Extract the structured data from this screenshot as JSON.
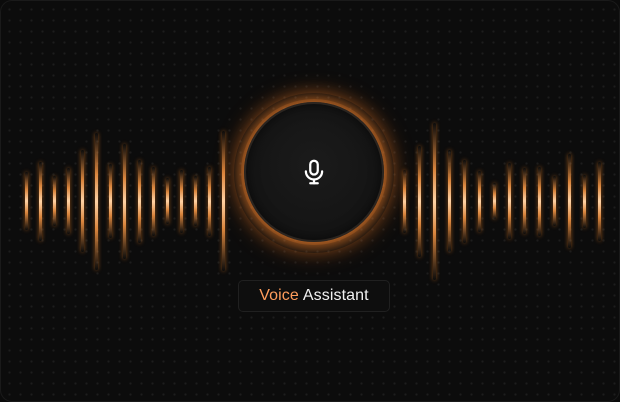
{
  "assistant": {
    "label_accent": "Voice",
    "label_rest": "Assistant",
    "icon": "microphone-icon"
  },
  "theme": {
    "accent": "#ff9d5c",
    "glow": "#ff8a2e",
    "background": "#0c0c0c",
    "text": "#f2f2f2"
  },
  "waveform": {
    "left_levels": [
      0.35,
      0.48,
      0.3,
      0.4,
      0.62,
      0.83,
      0.45,
      0.7,
      0.5,
      0.42,
      0.28,
      0.38,
      0.3,
      0.42,
      0.85
    ],
    "right_levels": [
      0.38,
      0.67,
      0.95,
      0.62,
      0.5,
      0.37,
      0.22,
      0.46,
      0.4,
      0.42,
      0.3,
      0.57,
      0.32,
      0.48
    ]
  }
}
